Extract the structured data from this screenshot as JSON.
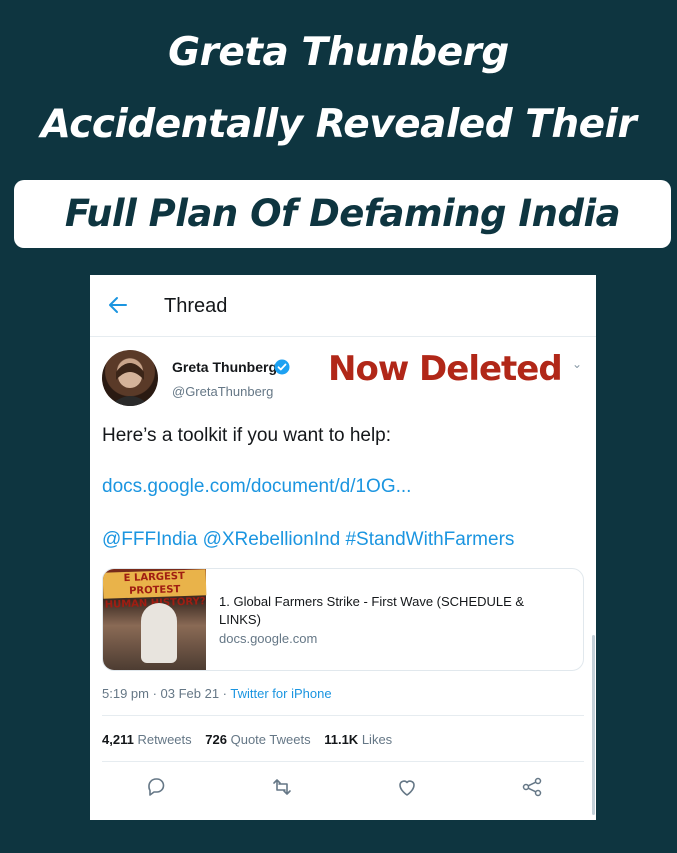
{
  "headline": {
    "line1": "Greta Thunberg",
    "line2": "Accidentally Revealed Their",
    "banner": "Full Plan Of Defaming India"
  },
  "thread": {
    "title": "Thread",
    "back_icon": "arrow-left-icon"
  },
  "tweet": {
    "name": "Greta Thunberg",
    "handle": "@GretaThunberg",
    "verified_icon": "verified-badge-icon",
    "overlay": "Now Deleted",
    "caret": "⌄",
    "text": "Here’s a toolkit if you want to help:",
    "link": "docs.google.com/document/d/1OG...",
    "mentions": "@FFFIndia @XRebellionInd #StandWithFarmers",
    "card": {
      "thumb_text_line1": "E LARGEST PROTEST",
      "thumb_text_line2": "HUMAN HISTORY?",
      "title": "1. Global Farmers Strike - First Wave (SCHEDULE & LINKS)",
      "domain": "docs.google.com"
    },
    "time": "5:19 pm · 03 Feb 21 · ",
    "source": "Twitter for iPhone",
    "stats": {
      "retweets_count": "4,211",
      "retweets_label": "Retweets",
      "quotes_count": "726",
      "quotes_label": "Quote Tweets",
      "likes_count": "11.1K",
      "likes_label": "Likes"
    }
  },
  "colors": {
    "background": "#0e3540",
    "link": "#1b95e0",
    "deleted": "#b12718"
  }
}
